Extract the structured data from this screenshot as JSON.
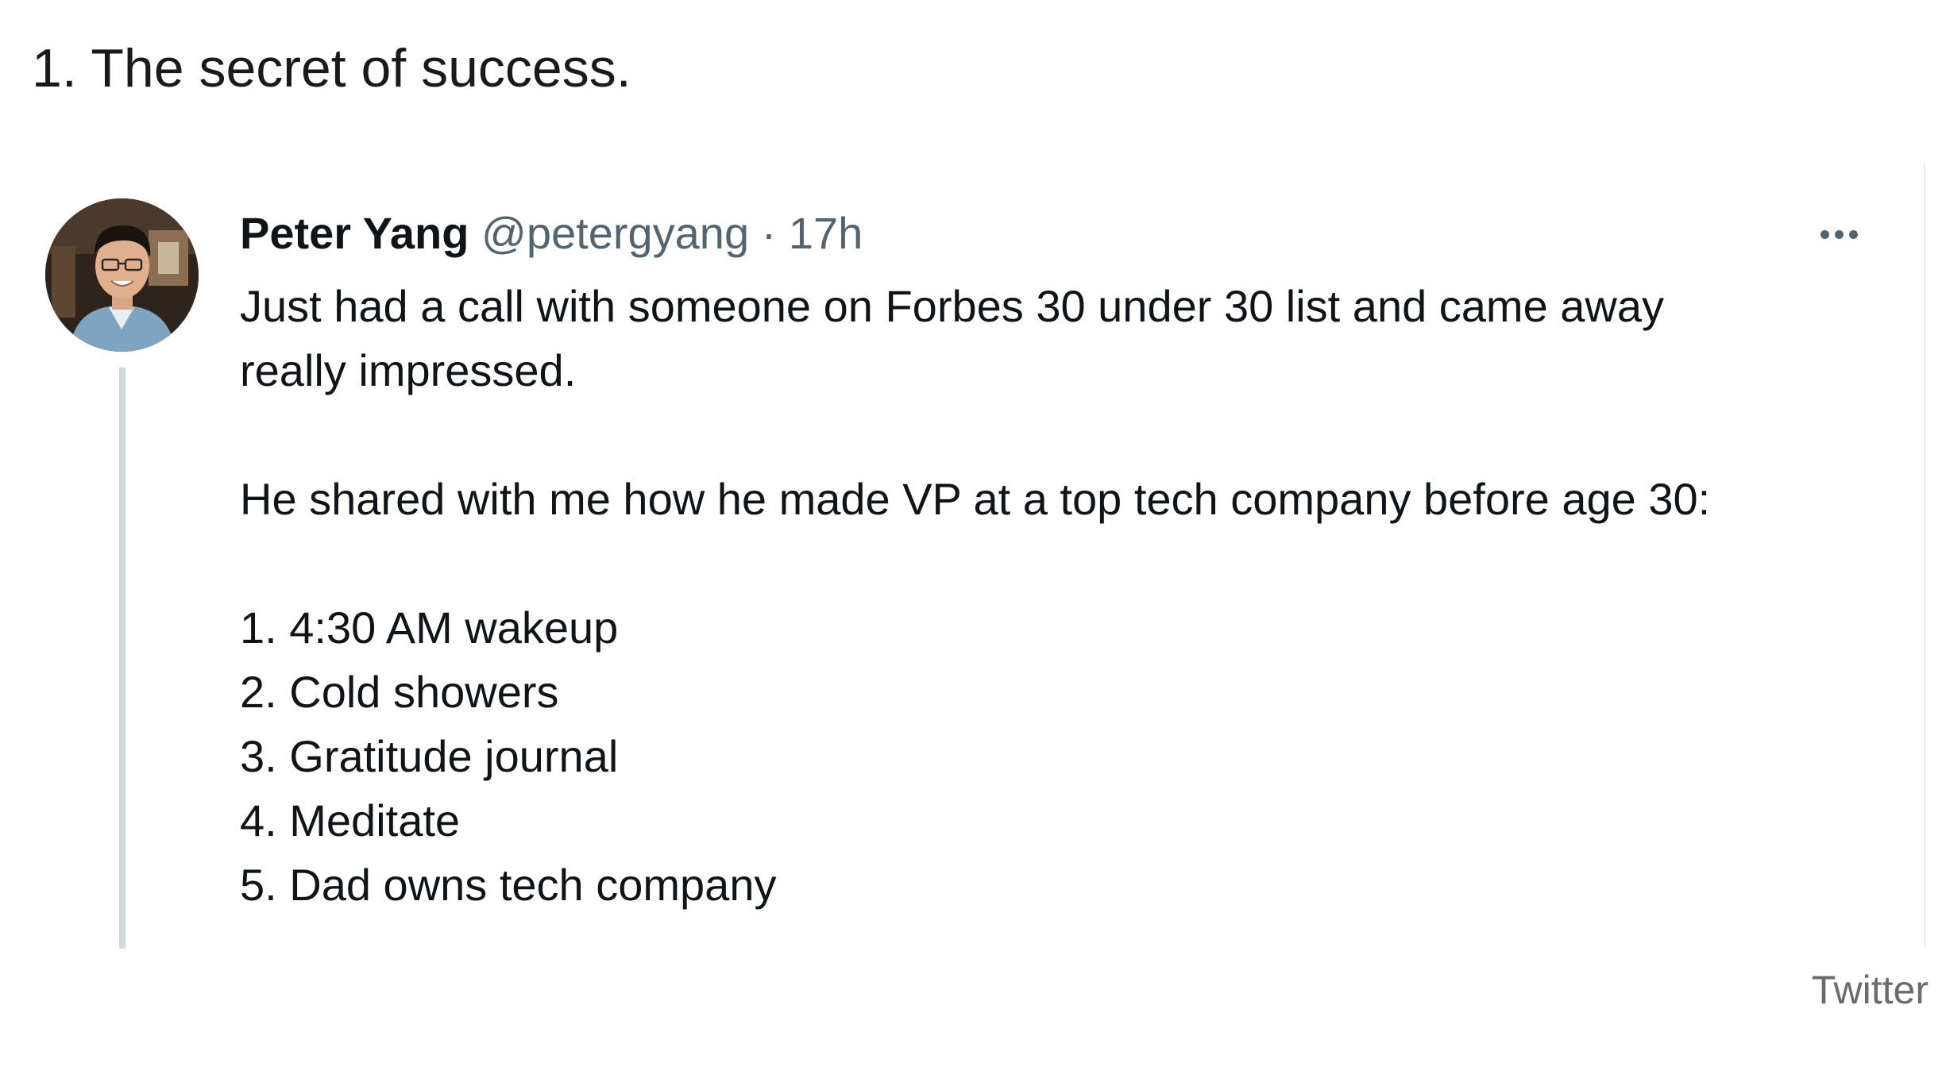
{
  "heading": "1. The secret of success.",
  "tweet": {
    "author": {
      "display_name": "Peter Yang",
      "handle": "@petergyang"
    },
    "separator": "·",
    "timestamp": "17h",
    "more_icon": "more-horizontal-icon",
    "lines": {
      "intro_1": "Just had a call with someone on Forbes 30 under 30 list and came away",
      "intro_2": "really impressed.",
      "shared": "He shared with me how he made VP at a top tech company before age 30:"
    },
    "list": [
      "1. 4:30 AM wakeup",
      "2. Cold showers",
      "3. Gratitude journal",
      "4. Meditate",
      "5. Dad owns tech company"
    ]
  },
  "source": "Twitter",
  "colors": {
    "text_primary": "#0f1419",
    "text_secondary": "#536471",
    "thread_line": "#cfd9de"
  }
}
